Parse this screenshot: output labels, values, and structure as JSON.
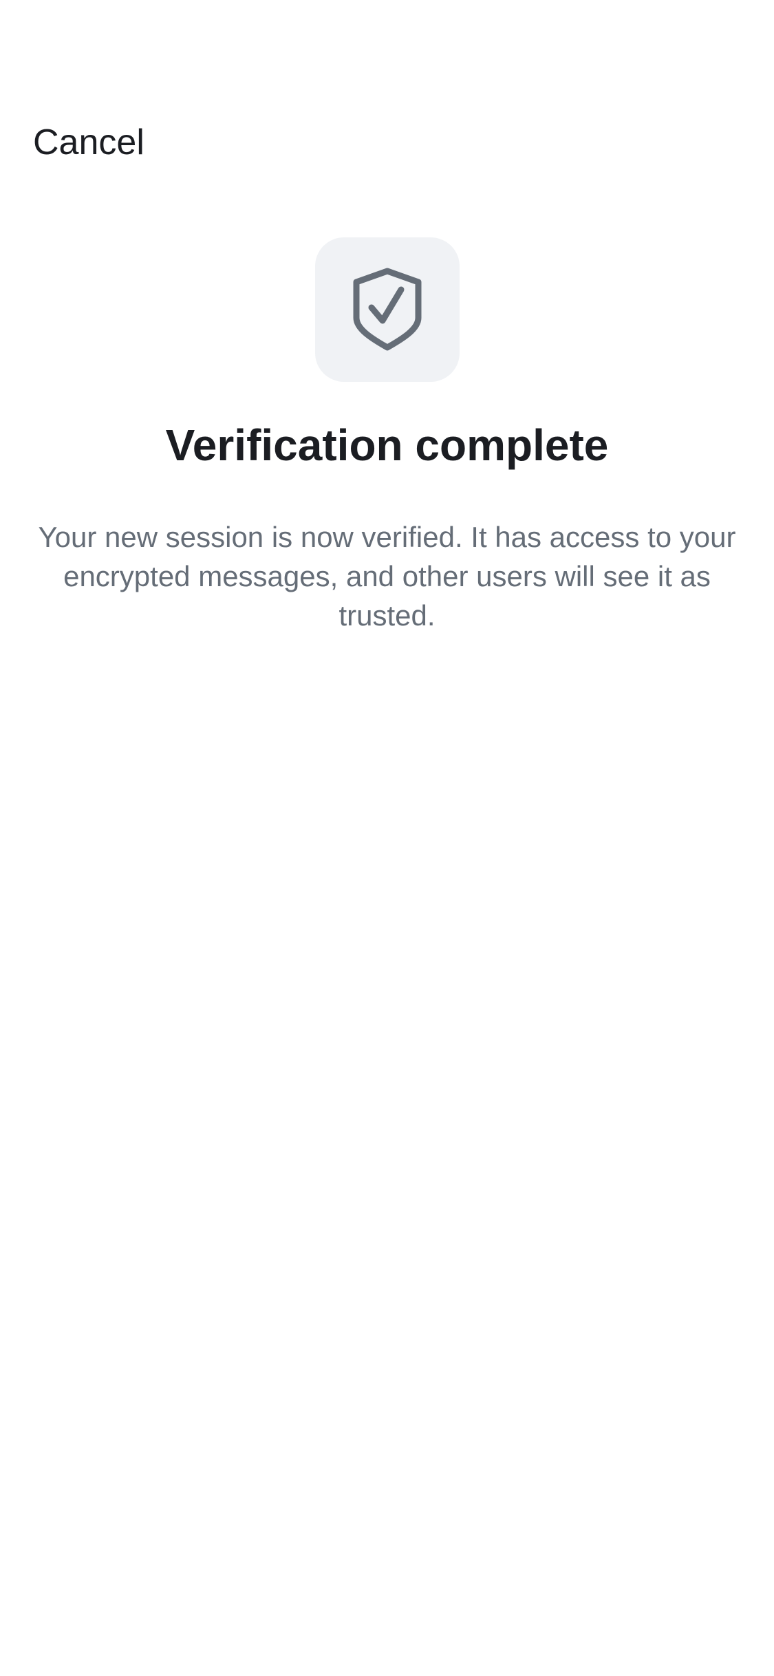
{
  "header": {
    "cancel_label": "Cancel"
  },
  "main": {
    "icon": "shield-check-icon",
    "title": "Verification complete",
    "description": "Your new session is now verified. It has access to your encrypted messages, and other users will see it as trusted."
  },
  "colors": {
    "background": "#ffffff",
    "icon_tile": "#f0f2f5",
    "icon_stroke": "#656d77",
    "title_text": "#1b1d22",
    "body_text": "#656d77"
  }
}
